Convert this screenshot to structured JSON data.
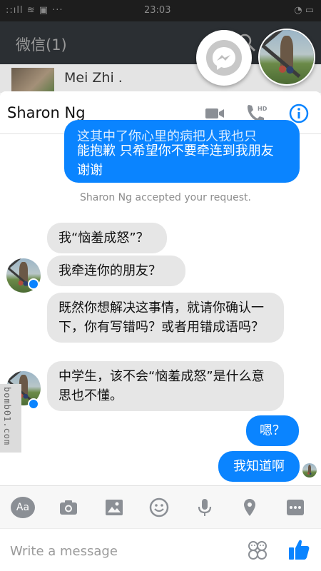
{
  "status_bar": {
    "left": "::ıll ≋ ▣ ···",
    "time": "23:03",
    "right": "◔ ▭"
  },
  "wechat": {
    "title": "微信(1)",
    "contact_name": "Mei Zhi ."
  },
  "chat": {
    "contact_name": "Sharon Ng",
    "sent_partial": [
      "这其中了你心里的病把人我也只",
      "能抱歉 只希望你不要牵连到我朋友 谢谢"
    ],
    "system_message": "Sharon Ng accepted your request.",
    "messages": [
      {
        "from": "them",
        "text": "我“恼羞成怒”？"
      },
      {
        "from": "them",
        "text": "我牵连你的朋友？"
      },
      {
        "from": "them",
        "text": "既然你想解决这事情，就请你确认一下，你有写错吗？或者用错成语吗？"
      },
      {
        "from": "them",
        "text": "中学生，该不会“恼羞成怒”是什么意思也不懂。"
      },
      {
        "from": "me",
        "text": "嗯？"
      },
      {
        "from": "me",
        "text": "我知道啊"
      }
    ]
  },
  "watermark": "bomb01.com",
  "composer": {
    "aa_label": "Aa",
    "placeholder": "Write a message"
  },
  "colors": {
    "accent": "#0a84ff",
    "incoming_bubble": "#e6e6e6",
    "header_dark": "#2b2f33"
  },
  "icons": [
    "video-icon",
    "phone-hd-icon",
    "info-icon",
    "camera-icon",
    "image-icon",
    "emoji-icon",
    "microphone-icon",
    "location-icon",
    "more-icon",
    "sticker-icon",
    "thumbs-up-icon",
    "messenger-icon",
    "search-icon"
  ]
}
